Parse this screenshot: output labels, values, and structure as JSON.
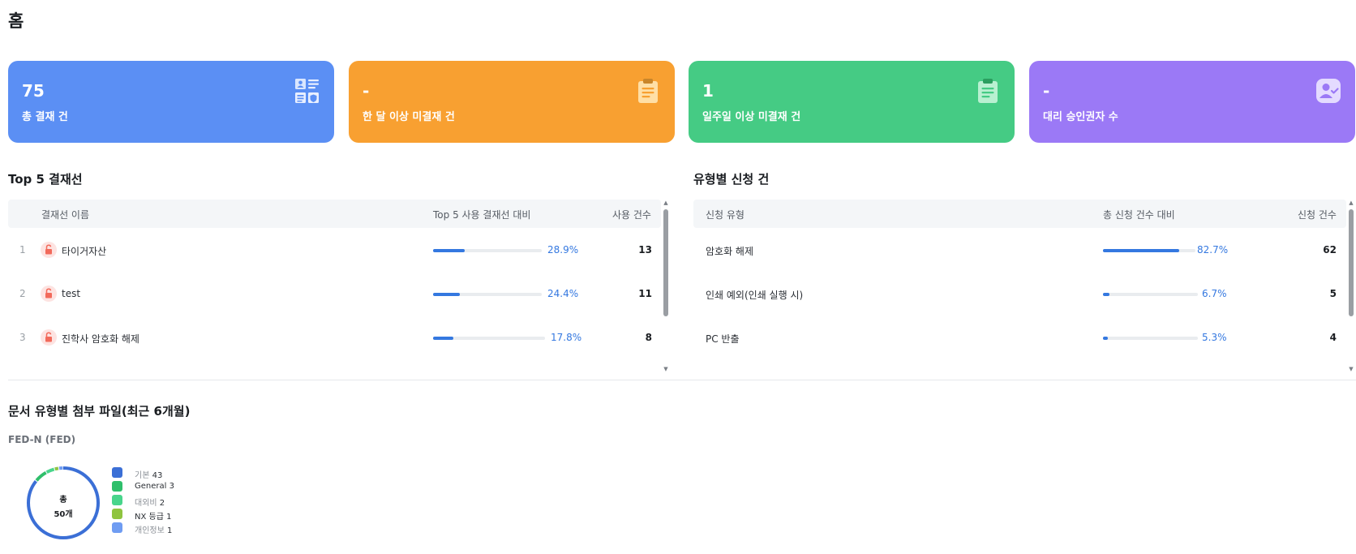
{
  "page": {
    "title": "홈"
  },
  "cards": [
    {
      "value": "75",
      "label": "총 결재 건",
      "color": "#5b8ff4",
      "icon": "approval-grid-icon"
    },
    {
      "value": "-",
      "label": "한 달 이상 미결재 건",
      "color": "#f8a031",
      "icon": "clipboard-icon"
    },
    {
      "value": "1",
      "label": "일주일 이상 미결재 건",
      "color": "#45cb84",
      "icon": "clipboard-icon"
    },
    {
      "value": "-",
      "label": "대리 승인권자 수",
      "color": "#9b79f6",
      "icon": "user-check-icon"
    }
  ],
  "top5": {
    "title": "Top 5 결재선",
    "headers": {
      "name": "결재선 이름",
      "ratio": "Top 5 사용 결재선 대비",
      "count": "사용 건수"
    },
    "rows": [
      {
        "rank": "1",
        "name": "타이거자산",
        "percent": "28.9%",
        "fraction": 0.289,
        "count": "13"
      },
      {
        "rank": "2",
        "name": "test",
        "percent": "24.4%",
        "fraction": 0.244,
        "count": "11"
      },
      {
        "rank": "3",
        "name": "진학사 암호화 해제",
        "percent": "17.8%",
        "fraction": 0.178,
        "count": "8"
      }
    ]
  },
  "bytype": {
    "title": "유형별 신청 건",
    "headers": {
      "type": "신청 유형",
      "ratio": "총 신청 건수 대비",
      "count": "신청 건수"
    },
    "rows": [
      {
        "name": "암호화 해제",
        "percent": "82.7%",
        "fraction": 0.827,
        "count": "62"
      },
      {
        "name": "인쇄 예외(인쇄 실행 시)",
        "percent": "6.7%",
        "fraction": 0.067,
        "count": "5"
      },
      {
        "name": "PC 반출",
        "percent": "5.3%",
        "fraction": 0.053,
        "count": "4"
      }
    ]
  },
  "attachments": {
    "title": "문서 유형별 첨부 파일(최근 6개월)",
    "subtitle": "FED-N (FED)",
    "donut": {
      "total_label": "총",
      "total_value": "50개"
    },
    "legend": [
      {
        "label": "기본",
        "value": "43",
        "color": "#3b6fd6"
      },
      {
        "label": "General",
        "value": "3",
        "color": "#2fbf6b"
      },
      {
        "label": "대외비",
        "value": "2",
        "color": "#48d58b"
      },
      {
        "label": "NX 등급",
        "value": "1",
        "color": "#8fc43f"
      },
      {
        "label": "개인정보",
        "value": "1",
        "color": "#6f9cf2"
      }
    ]
  }
}
